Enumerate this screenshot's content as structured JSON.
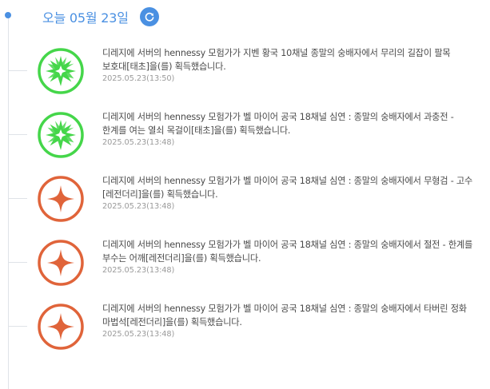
{
  "header": {
    "date_label": "오늘 05월 23일"
  },
  "colors": {
    "accent": "#4a90e2",
    "tier_green": "#45d64a",
    "tier_orange": "#e0643a"
  },
  "entries": [
    {
      "icon": "green-burst-icon",
      "message": "디레지에 서버의 hennessy 모험가가 지벤 황국 10채널 종말의 숭배자에서 무리의 길잡이 팔목 보호대[태초]을(를) 획득했습니다.",
      "time": "2025.05.23(13:50)"
    },
    {
      "icon": "green-burst-icon",
      "message": "디레지에 서버의 hennessy 모험가가 벨 마이어 공국 18채널 심연 : 종말의 숭배자에서 과충전 - 한계를 여는 열쇠 목걸이[태초]을(를) 획득했습니다.",
      "time": "2025.05.23(13:48)"
    },
    {
      "icon": "orange-star-icon",
      "message": "디레지에 서버의 hennessy 모험가가 벨 마이어 공국 18채널 심연 : 종말의 숭배자에서 무형검 - 고수[레전더리]을(를) 획득했습니다.",
      "time": "2025.05.23(13:48)"
    },
    {
      "icon": "orange-star-icon",
      "message": "디레지에 서버의 hennessy 모험가가 벨 마이어 공국 18채널 심연 : 종말의 숭배자에서 절전 - 한계를 부수는 어깨[레전더리]을(를) 획득했습니다.",
      "time": "2025.05.23(13:48)"
    },
    {
      "icon": "orange-star-icon",
      "message": "디레지에 서버의 hennessy 모험가가 벨 마이어 공국 18채널 심연 : 종말의 숭배자에서 타버린 정화 마법석[레전더리]을(를) 획득했습니다.",
      "time": "2025.05.23(13:48)"
    }
  ]
}
